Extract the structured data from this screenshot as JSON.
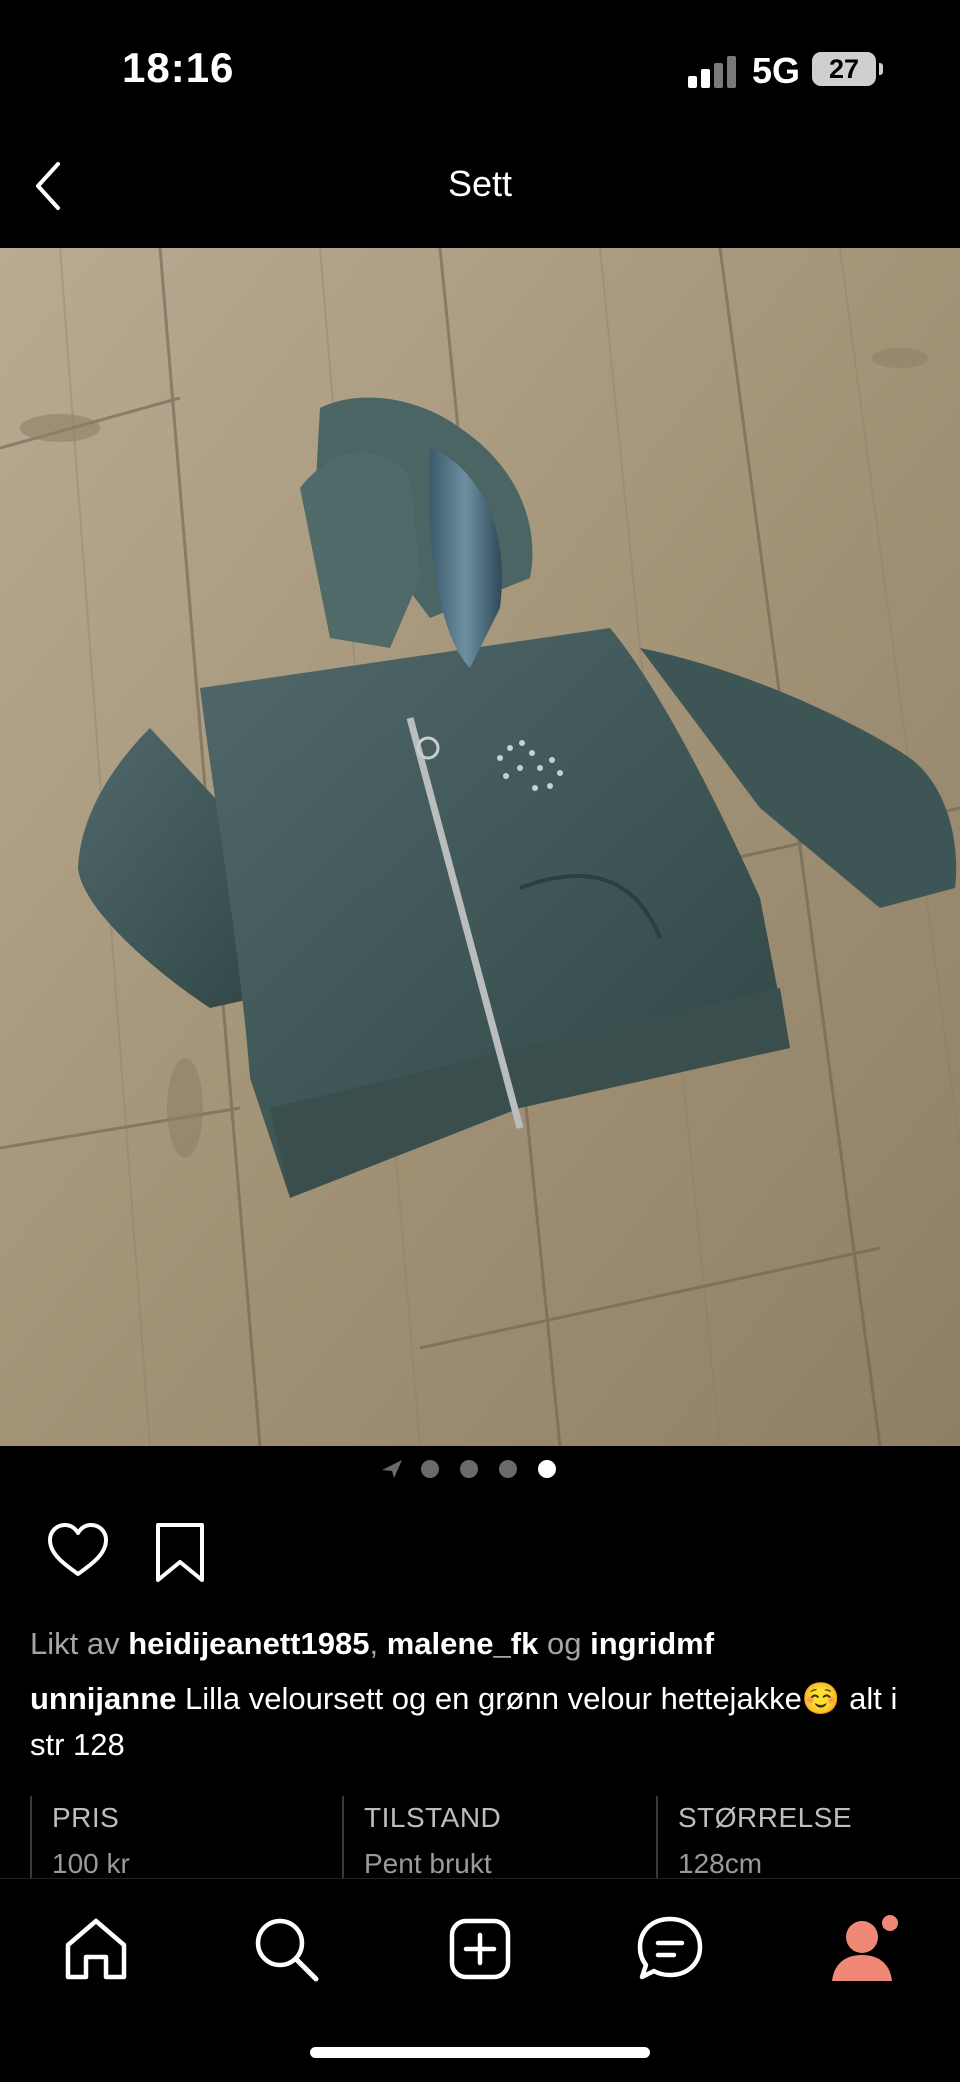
{
  "status_bar": {
    "time": "18:16",
    "network": "5G",
    "battery": "27"
  },
  "header": {
    "title": "Sett",
    "back_icon": "chevron-left-icon"
  },
  "carousel": {
    "count": 4,
    "active_index": 3,
    "location_icon": "location-arrow-icon"
  },
  "actions": {
    "like_icon": "heart-icon",
    "save_icon": "bookmark-icon"
  },
  "likes": {
    "prefix": "Likt av",
    "users": [
      "heidijeanett1985",
      "malene_fk",
      "ingridmf"
    ],
    "sep1": ",",
    "conj": "og"
  },
  "post": {
    "author": "unnijanne",
    "text": "Lilla veloursett og en grønn velour hettejakke☺️ alt i str 128"
  },
  "specs": [
    {
      "label": "PRIS",
      "value": "100 kr"
    },
    {
      "label": "TILSTAND",
      "value": "Pent brukt"
    },
    {
      "label": "STØRRELSE",
      "value": "128cm"
    }
  ],
  "tabbar": {
    "items": [
      "home-icon",
      "search-icon",
      "add-icon",
      "messages-icon",
      "profile-icon"
    ],
    "accent": "#f08878"
  }
}
